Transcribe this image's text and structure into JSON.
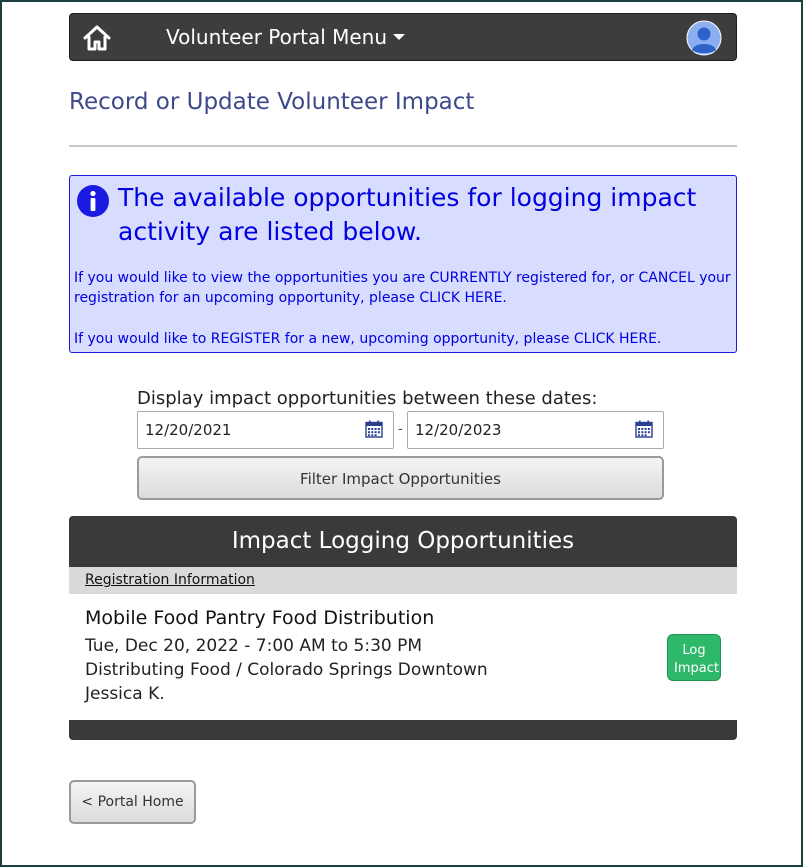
{
  "navbar": {
    "home_icon": "home-icon",
    "menu_label": "Volunteer Portal Menu",
    "avatar_icon": "user-avatar-icon",
    "background_color": "#3d3d3d"
  },
  "page": {
    "title": "Record or Update Volunteer Impact",
    "title_color": "#3d4a8a"
  },
  "info": {
    "icon": "info-circle-icon",
    "headline": "The available opportunities for logging impact activity are listed below.",
    "line1": "If you would like to view the opportunities you are CURRENTLY registered for, or CANCEL your registration for an upcoming opportunity, please CLICK HERE.",
    "line2": "If you would like to REGISTER for a new, upcoming opportunity, please CLICK HERE.",
    "background_color": "#d8dcff",
    "text_color": "#0000e0"
  },
  "filter": {
    "label": "Display impact opportunities between these dates:",
    "from_date": "12/20/2021",
    "separator": "-",
    "to_date": "12/20/2023",
    "calendar_icon": "calendar-icon",
    "button_label": "Filter Impact Opportunities"
  },
  "panel": {
    "header": "Impact Logging Opportunities",
    "subheader_link": "Registration Information",
    "opportunities": [
      {
        "title": "Mobile Food Pantry Food Distribution",
        "datetime": "Tue, Dec 20, 2022 - 7:00 AM to 5:30 PM",
        "location": "Distributing Food / Colorado Springs Downtown",
        "contact": "Jessica K.",
        "button_line1": "Log",
        "button_line2": "Impact",
        "button_color": "#2db86a"
      }
    ]
  },
  "footer": {
    "home_button": "< Portal Home"
  }
}
